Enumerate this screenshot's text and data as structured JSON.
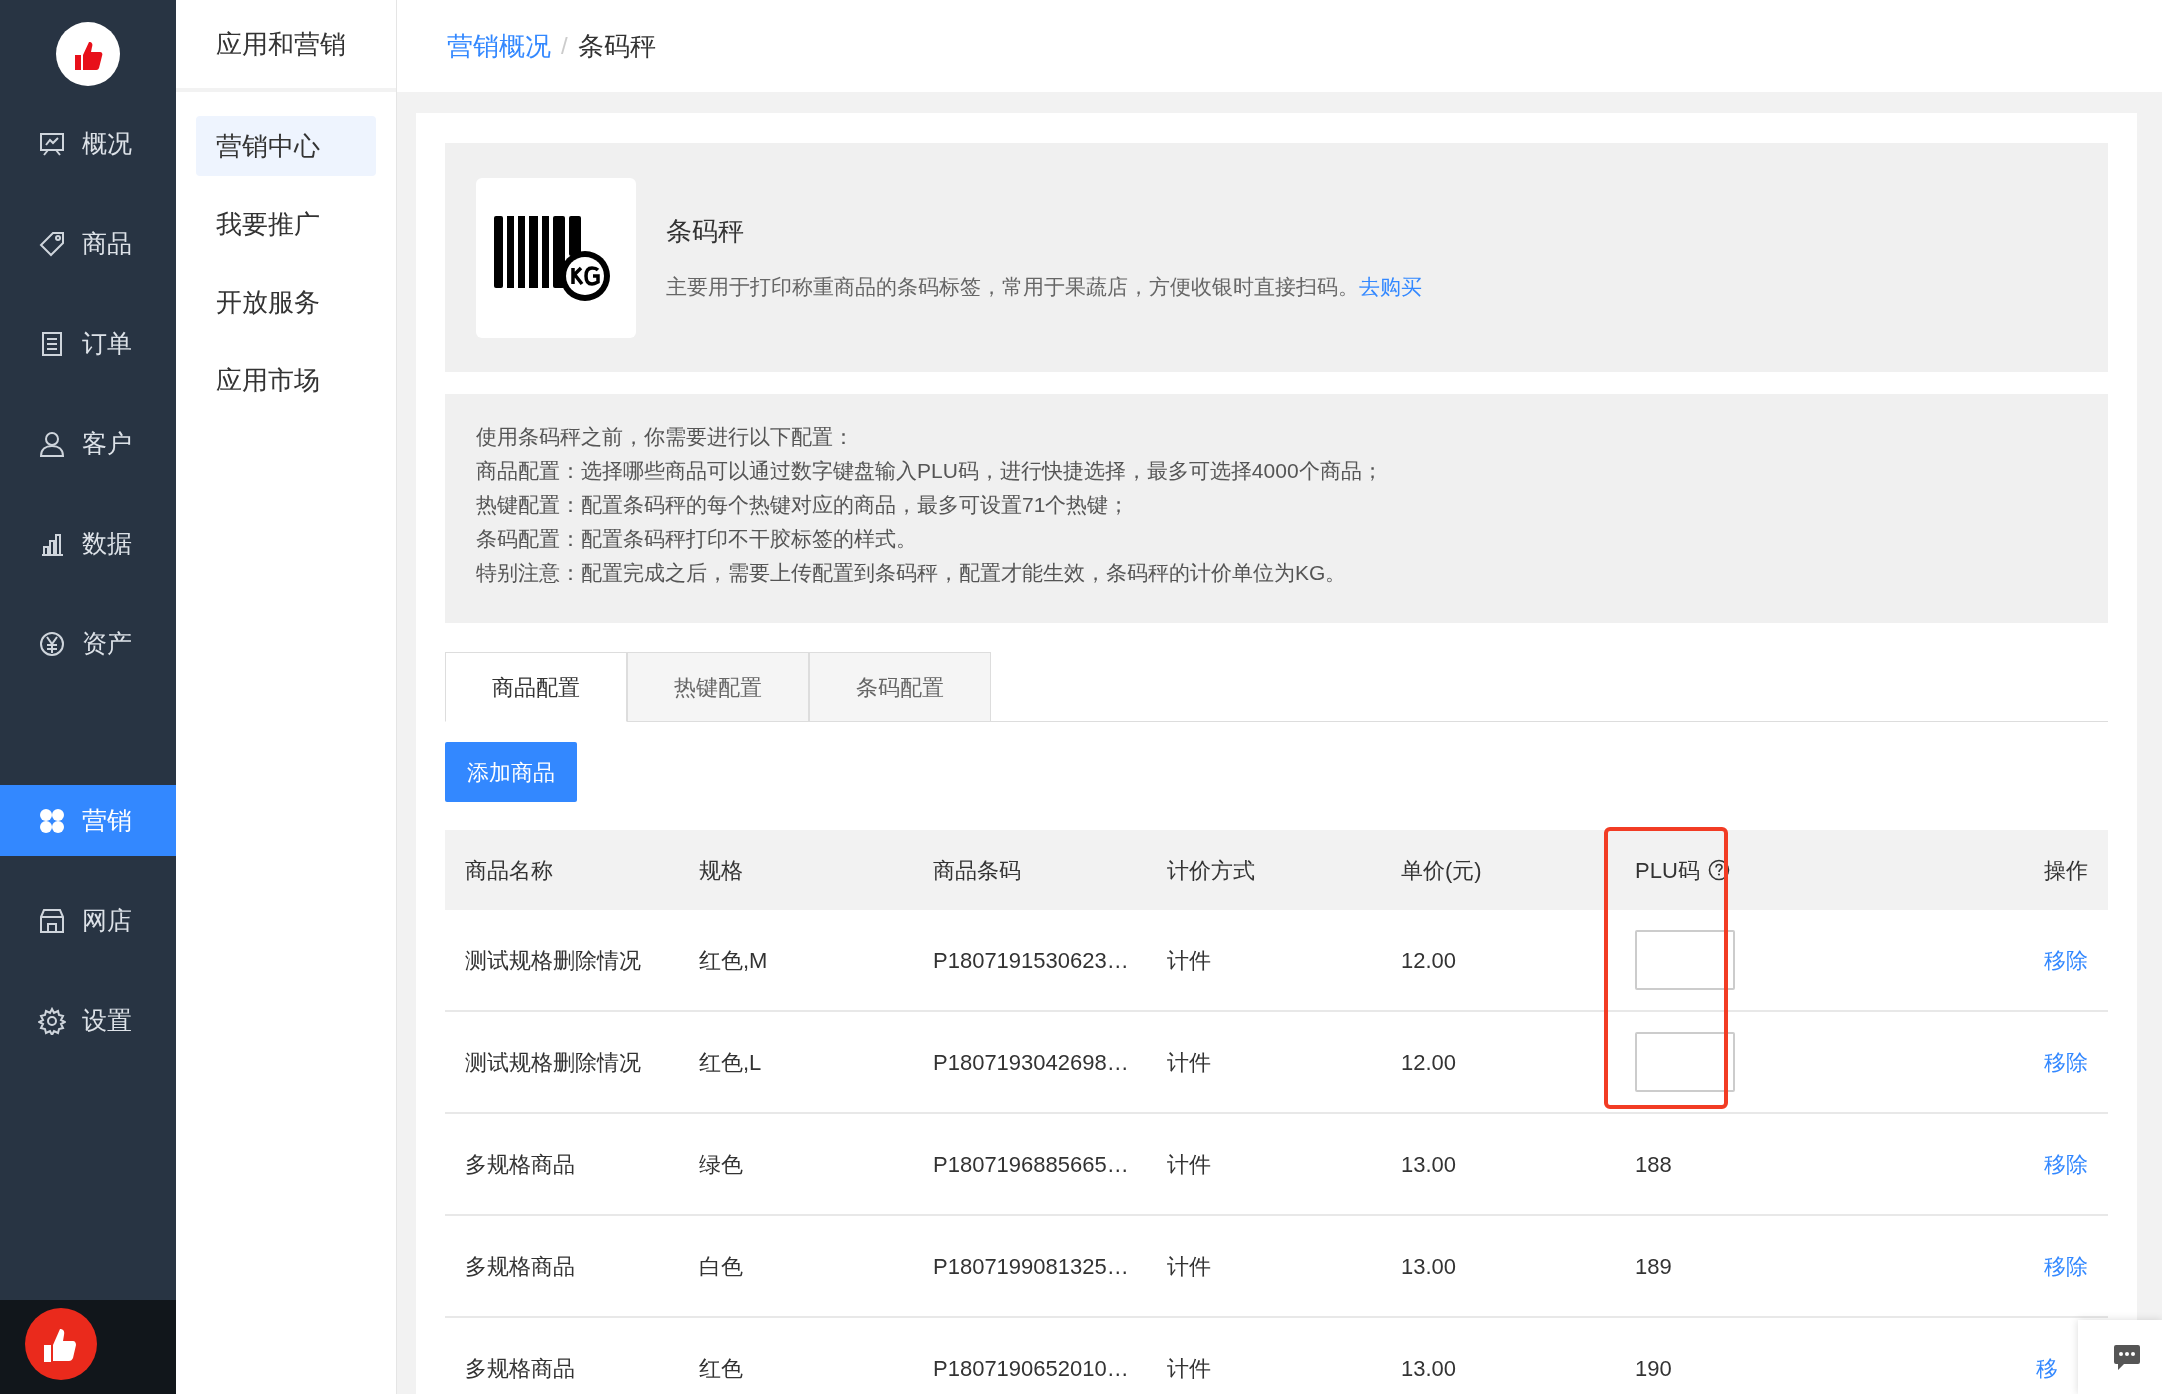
{
  "nav": {
    "items": [
      {
        "label": "概况",
        "selected": false
      },
      {
        "label": "商品",
        "selected": false
      },
      {
        "label": "订单",
        "selected": false
      },
      {
        "label": "客户",
        "selected": false
      },
      {
        "label": "数据",
        "selected": false
      },
      {
        "label": "资产",
        "selected": false
      },
      {
        "label": "营销",
        "selected": true
      },
      {
        "label": "网店",
        "selected": false
      },
      {
        "label": "设置",
        "selected": false
      }
    ]
  },
  "submenu": {
    "title": "应用和营销",
    "items": [
      {
        "label": "营销中心",
        "selected": true
      },
      {
        "label": "我要推广",
        "selected": false
      },
      {
        "label": "开放服务",
        "selected": false
      },
      {
        "label": "应用市场",
        "selected": false
      }
    ]
  },
  "breadcrumb": {
    "items": [
      {
        "label": "营销概况",
        "kind": "link"
      },
      {
        "label": "条码秤",
        "kind": "current"
      }
    ],
    "separator": "/"
  },
  "app": {
    "title": "条码秤",
    "description": "主要用于打印称重商品的条码标签，常用于果蔬店，方便收银时直接扫码。",
    "link": "去购买"
  },
  "notes": [
    "使用条码秤之前，你需要进行以下配置：",
    "商品配置：选择哪些商品可以通过数字键盘输入PLU码，进行快捷选择，最多可选择4000个商品；",
    "热键配置：配置条码秤的每个热键对应的商品，最多可设置71个热键；",
    "条码配置：配置条码秤打印不干胶标签的样式。",
    "特别注意：配置完成之后，需要上传配置到条码秤，配置才能生效，条码秤的计价单位为KG。"
  ],
  "tabs": [
    {
      "label": "商品配置",
      "selected": true
    },
    {
      "label": "热键配置",
      "selected": false
    },
    {
      "label": "条码配置",
      "selected": false
    }
  ],
  "add_button": "添加商品",
  "table": {
    "columns": [
      "商品名称",
      "规格",
      "商品条码",
      "计价方式",
      "单价(元)",
      "PLU码",
      "操作"
    ],
    "rows": [
      {
        "cells": [
          "测试规格删除情况",
          "红色,M",
          "P1807191530623…",
          "计件",
          "12.00"
        ],
        "plu": {
          "kind": "input"
        },
        "action": "移除"
      },
      {
        "cells": [
          "测试规格删除情况",
          "红色,L",
          "P1807193042698…",
          "计件",
          "12.00"
        ],
        "plu": {
          "kind": "input"
        },
        "action": "移除"
      },
      {
        "cells": [
          "多规格商品",
          "绿色",
          "P1807196885665…",
          "计件",
          "13.00"
        ],
        "plu": {
          "kind": "text",
          "text": "188"
        },
        "action": "移除"
      },
      {
        "cells": [
          "多规格商品",
          "白色",
          "P1807199081325…",
          "计件",
          "13.00"
        ],
        "plu": {
          "kind": "text",
          "text": "189"
        },
        "action": "移除"
      },
      {
        "cells": [
          "多规格商品",
          "红色",
          "P1807190652010…",
          "计件",
          "13.00"
        ],
        "plu": {
          "kind": "text",
          "text": "190"
        },
        "action": "移"
      }
    ]
  }
}
